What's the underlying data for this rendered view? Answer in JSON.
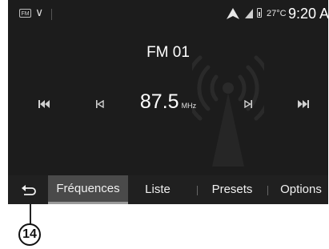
{
  "status_bar": {
    "source_icon_label": "FM",
    "source_icon": "radio-source-icon",
    "chevron_icon": "chevron-down-icon",
    "navigation_icon": "navigation-arrow-icon",
    "signal_icon": "signal-strength-icon",
    "battery_icon": "battery-icon",
    "temperature": "27°C",
    "time": "9:20 AM"
  },
  "radio": {
    "band": "FM 01",
    "frequency_value": "87.5",
    "frequency_unit": "MHz",
    "controls": {
      "prev_station_icon": "skip-previous-icon",
      "seek_back_icon": "seek-back-icon",
      "seek_forward_icon": "seek-forward-icon",
      "next_station_icon": "skip-next-icon"
    }
  },
  "tabs": [
    {
      "label": "Fréquences",
      "active": true
    },
    {
      "label": "Liste",
      "active": false
    },
    {
      "label": "Presets",
      "active": false
    },
    {
      "label": "Options",
      "active": false
    }
  ],
  "back_icon": "back-arrow-icon",
  "callout": {
    "number": "14"
  },
  "colors": {
    "screen_bg": "#1c1c1c",
    "active_tab_bg": "#4a4a4a",
    "text": "#ffffff"
  }
}
